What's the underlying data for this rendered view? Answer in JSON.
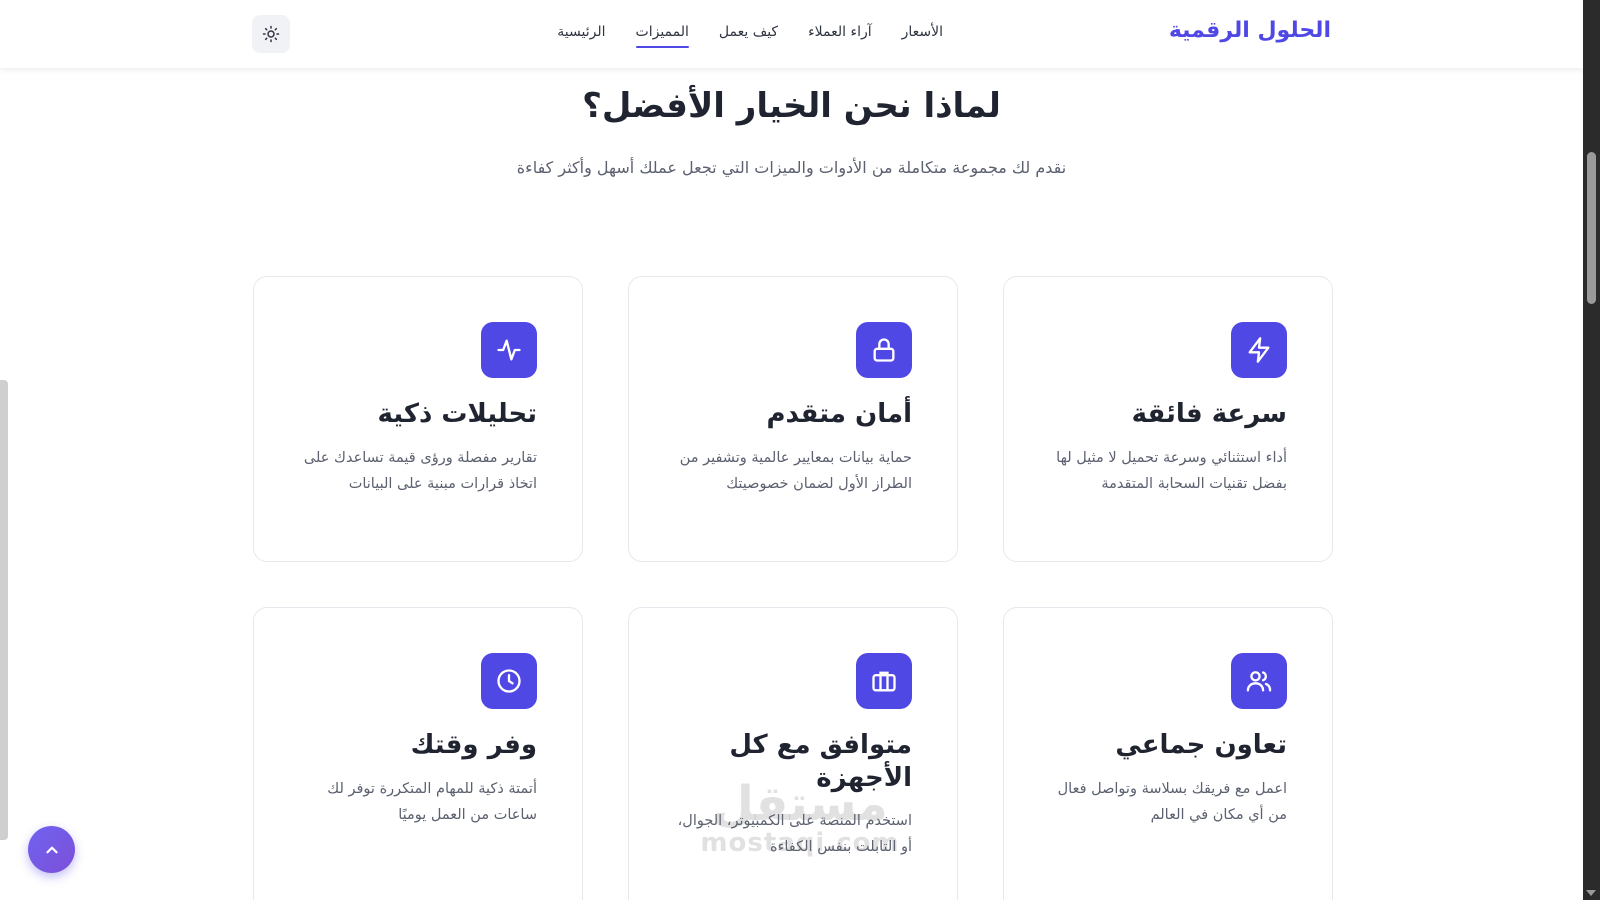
{
  "header": {
    "brand": "الحلول الرقمية",
    "nav": [
      {
        "label": "الرئيسية",
        "active": false
      },
      {
        "label": "المميزات",
        "active": true
      },
      {
        "label": "كيف يعمل",
        "active": false
      },
      {
        "label": "آراء العملاء",
        "active": false
      },
      {
        "label": "الأسعار",
        "active": false
      }
    ],
    "theme_toggle_icon": "sun-icon"
  },
  "section": {
    "title": "لماذا نحن الخيار الأفضل؟",
    "subtitle": "نقدم لك مجموعة متكاملة من الأدوات والميزات التي تجعل عملك أسهل وأكثر كفاءة"
  },
  "features": [
    {
      "icon": "lightning-icon",
      "title": "سرعة فائقة",
      "text": "أداء استثنائي وسرعة تحميل لا مثيل لها بفضل تقنيات السحابة المتقدمة"
    },
    {
      "icon": "lock-icon",
      "title": "أمان متقدم",
      "text": "حماية بيانات بمعايير عالمية وتشفير من الطراز الأول لضمان خصوصيتك"
    },
    {
      "icon": "activity-icon",
      "title": "تحليلات ذكية",
      "text": "تقارير مفصلة ورؤى قيمة تساعدك على اتخاذ قرارات مبنية على البيانات"
    },
    {
      "icon": "users-icon",
      "title": "تعاون جماعي",
      "text": "اعمل مع فريقك بسلاسة وتواصل فعال من أي مكان في العالم"
    },
    {
      "icon": "briefcase-icon",
      "title": "متوافق مع كل الأجهزة",
      "text": "استخدم المنصة على الكمبيوتر، الجوال، أو التابلت بنفس الكفاءة"
    },
    {
      "icon": "clock-icon",
      "title": "وفر وقتك",
      "text": "أتمتة ذكية للمهام المتكررة توفر لك ساعات من العمل يوميًا"
    }
  ],
  "watermark": {
    "ar": "مستقل",
    "en": "mostaqi.com"
  },
  "colors": {
    "accent": "#5048e5",
    "text": "#1f2430",
    "muted": "#5c6170"
  }
}
